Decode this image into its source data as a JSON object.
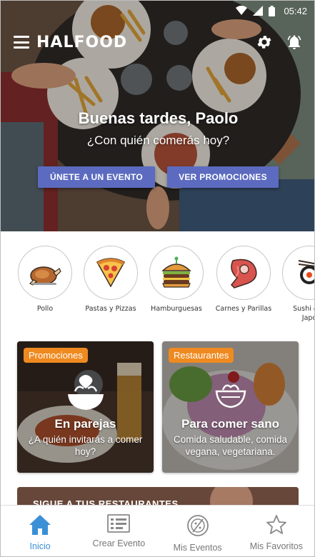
{
  "status_bar": {
    "time": "05:42"
  },
  "app": {
    "brand": "HALFOOD"
  },
  "hero": {
    "greeting": "Buenas tardes, Paolo",
    "subgreeting": "¿Con quién comerás hoy?",
    "join_button": "ÚNETE A UN EVENTO",
    "promos_button": "VER PROMOCIONES"
  },
  "categories": [
    {
      "label": "Pollo",
      "icon": "chicken-icon"
    },
    {
      "label": "Pastas y Pizzas",
      "icon": "pizza-icon"
    },
    {
      "label": "Hamburguesas",
      "icon": "burger-icon"
    },
    {
      "label": "Carnes y Parillas",
      "icon": "steak-icon"
    },
    {
      "label": "Sushi & C",
      "label2": "Japo",
      "icon": "sushi-icon"
    }
  ],
  "cards": [
    {
      "badge": "Promociones",
      "title": "En parejas",
      "subtitle": "¿A quién invitarás a comer hoy?",
      "icon": "bowl-heart-icon"
    },
    {
      "badge": "Restaurantes",
      "title": "Para comer sano",
      "subtitle": "Comida saludable, comida vegana, vegetariana.",
      "icon": "bowl-icon"
    }
  ],
  "follow": {
    "title": "SIGUE A TUS RESTAURANTES"
  },
  "bottom_nav": [
    {
      "label": "Inicio",
      "icon": "home-icon",
      "active": true
    },
    {
      "label": "Crear Evento",
      "icon": "create-event-icon",
      "active": false
    },
    {
      "label": "Mis Eventos",
      "icon": "events-icon",
      "active": false
    },
    {
      "label": "Mis Favoritos",
      "icon": "star-icon",
      "active": false
    }
  ],
  "colors": {
    "accent_button": "#5c6bc0",
    "badge": "#ef8a20",
    "nav_active": "#3b8fd6",
    "nav_inactive": "#777777"
  }
}
